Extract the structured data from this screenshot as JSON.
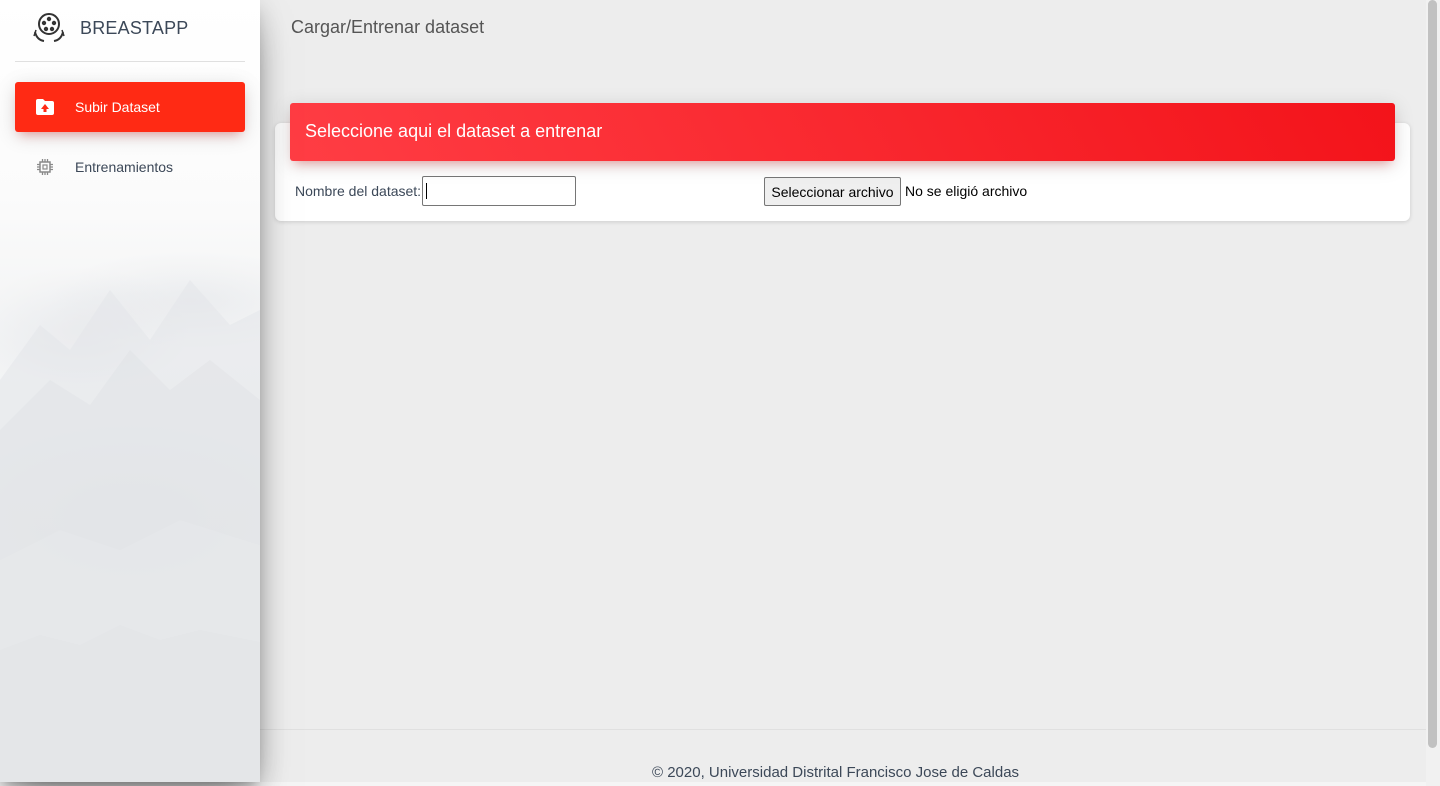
{
  "sidebar": {
    "brand": "BREASTAPP",
    "items": [
      {
        "label": "Subir Dataset",
        "icon": "upload-folder-icon",
        "active": true
      },
      {
        "label": "Entrenamientos",
        "icon": "chip-icon",
        "active": false
      }
    ]
  },
  "header": {
    "title": "Cargar/Entrenar dataset"
  },
  "card": {
    "title": "Seleccione aqui el dataset a entrenar",
    "name_label": "Nombre del dataset:",
    "name_value": "",
    "file_button": "Seleccionar archivo",
    "file_status": "No se eligió archivo"
  },
  "footer": {
    "copyright": "© 2020, Universidad Distrital Francisco Jose de Caldas"
  },
  "colors": {
    "accent": "#ff2a14",
    "header_gradient_start": "#ff3d44",
    "header_gradient_end": "#f3131a"
  }
}
